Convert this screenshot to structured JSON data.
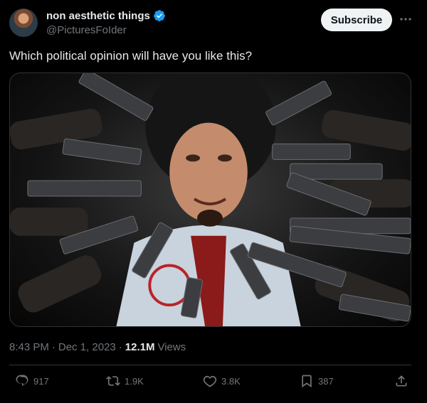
{
  "author": {
    "display_name": "non aesthetic things",
    "handle": "@PicturesFoIder",
    "verified_color": "#1d9bf0"
  },
  "header": {
    "subscribe_label": "Subscribe",
    "more_icon": "more-icon"
  },
  "tweet": {
    "text": "Which political opinion will have you like this?",
    "time": "8:43 PM",
    "sep1": "·",
    "date": "Dec 1, 2023",
    "sep2": "·",
    "views_count": "12.1M",
    "views_label": "Views"
  },
  "actions": {
    "replies": "917",
    "reposts": "1.9K",
    "likes": "3.8K",
    "bookmarks": "387"
  },
  "colors": {
    "background": "#000000",
    "text": "#e7e9ea",
    "muted": "#71767b",
    "accent": "#1d9bf0"
  }
}
